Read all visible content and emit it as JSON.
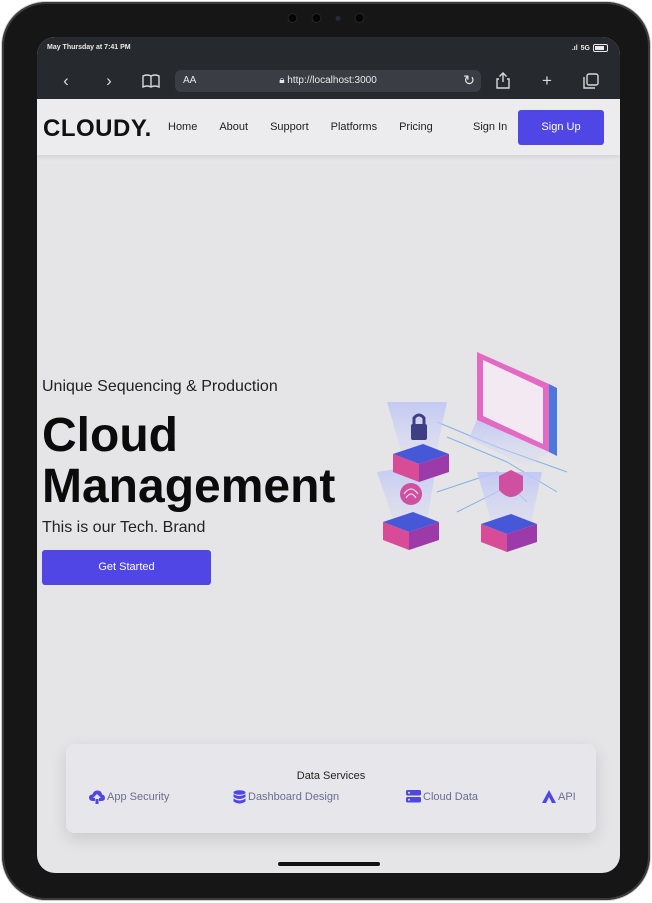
{
  "status_bar": {
    "time": "May Thursday at 7:41 PM",
    "carrier": "5G"
  },
  "browser": {
    "text_size_label": "AA",
    "url": "http://localhost:3000"
  },
  "nav": {
    "logo": "CLOUDY.",
    "links": [
      "Home",
      "About",
      "Support",
      "Platforms",
      "Pricing"
    ],
    "sign_in": "Sign In",
    "sign_up": "Sign Up"
  },
  "hero": {
    "eyebrow": "Unique Sequencing & Production",
    "headline_line1": "Cloud",
    "headline_line2": "Management",
    "tagline": "This is our Tech. Brand",
    "cta": "Get Started"
  },
  "services": {
    "title": "Data Services",
    "items": [
      {
        "label": "App Security",
        "icon": "cloud-upload-icon"
      },
      {
        "label": "Dashboard Design",
        "icon": "database-icon"
      },
      {
        "label": "Cloud Data",
        "icon": "server-icon"
      },
      {
        "label": "API",
        "icon": "api-logo-icon"
      }
    ]
  },
  "colors": {
    "accent": "#4f46e5",
    "page_bg": "#e5e4e7",
    "service_text": "#6a6d95"
  }
}
